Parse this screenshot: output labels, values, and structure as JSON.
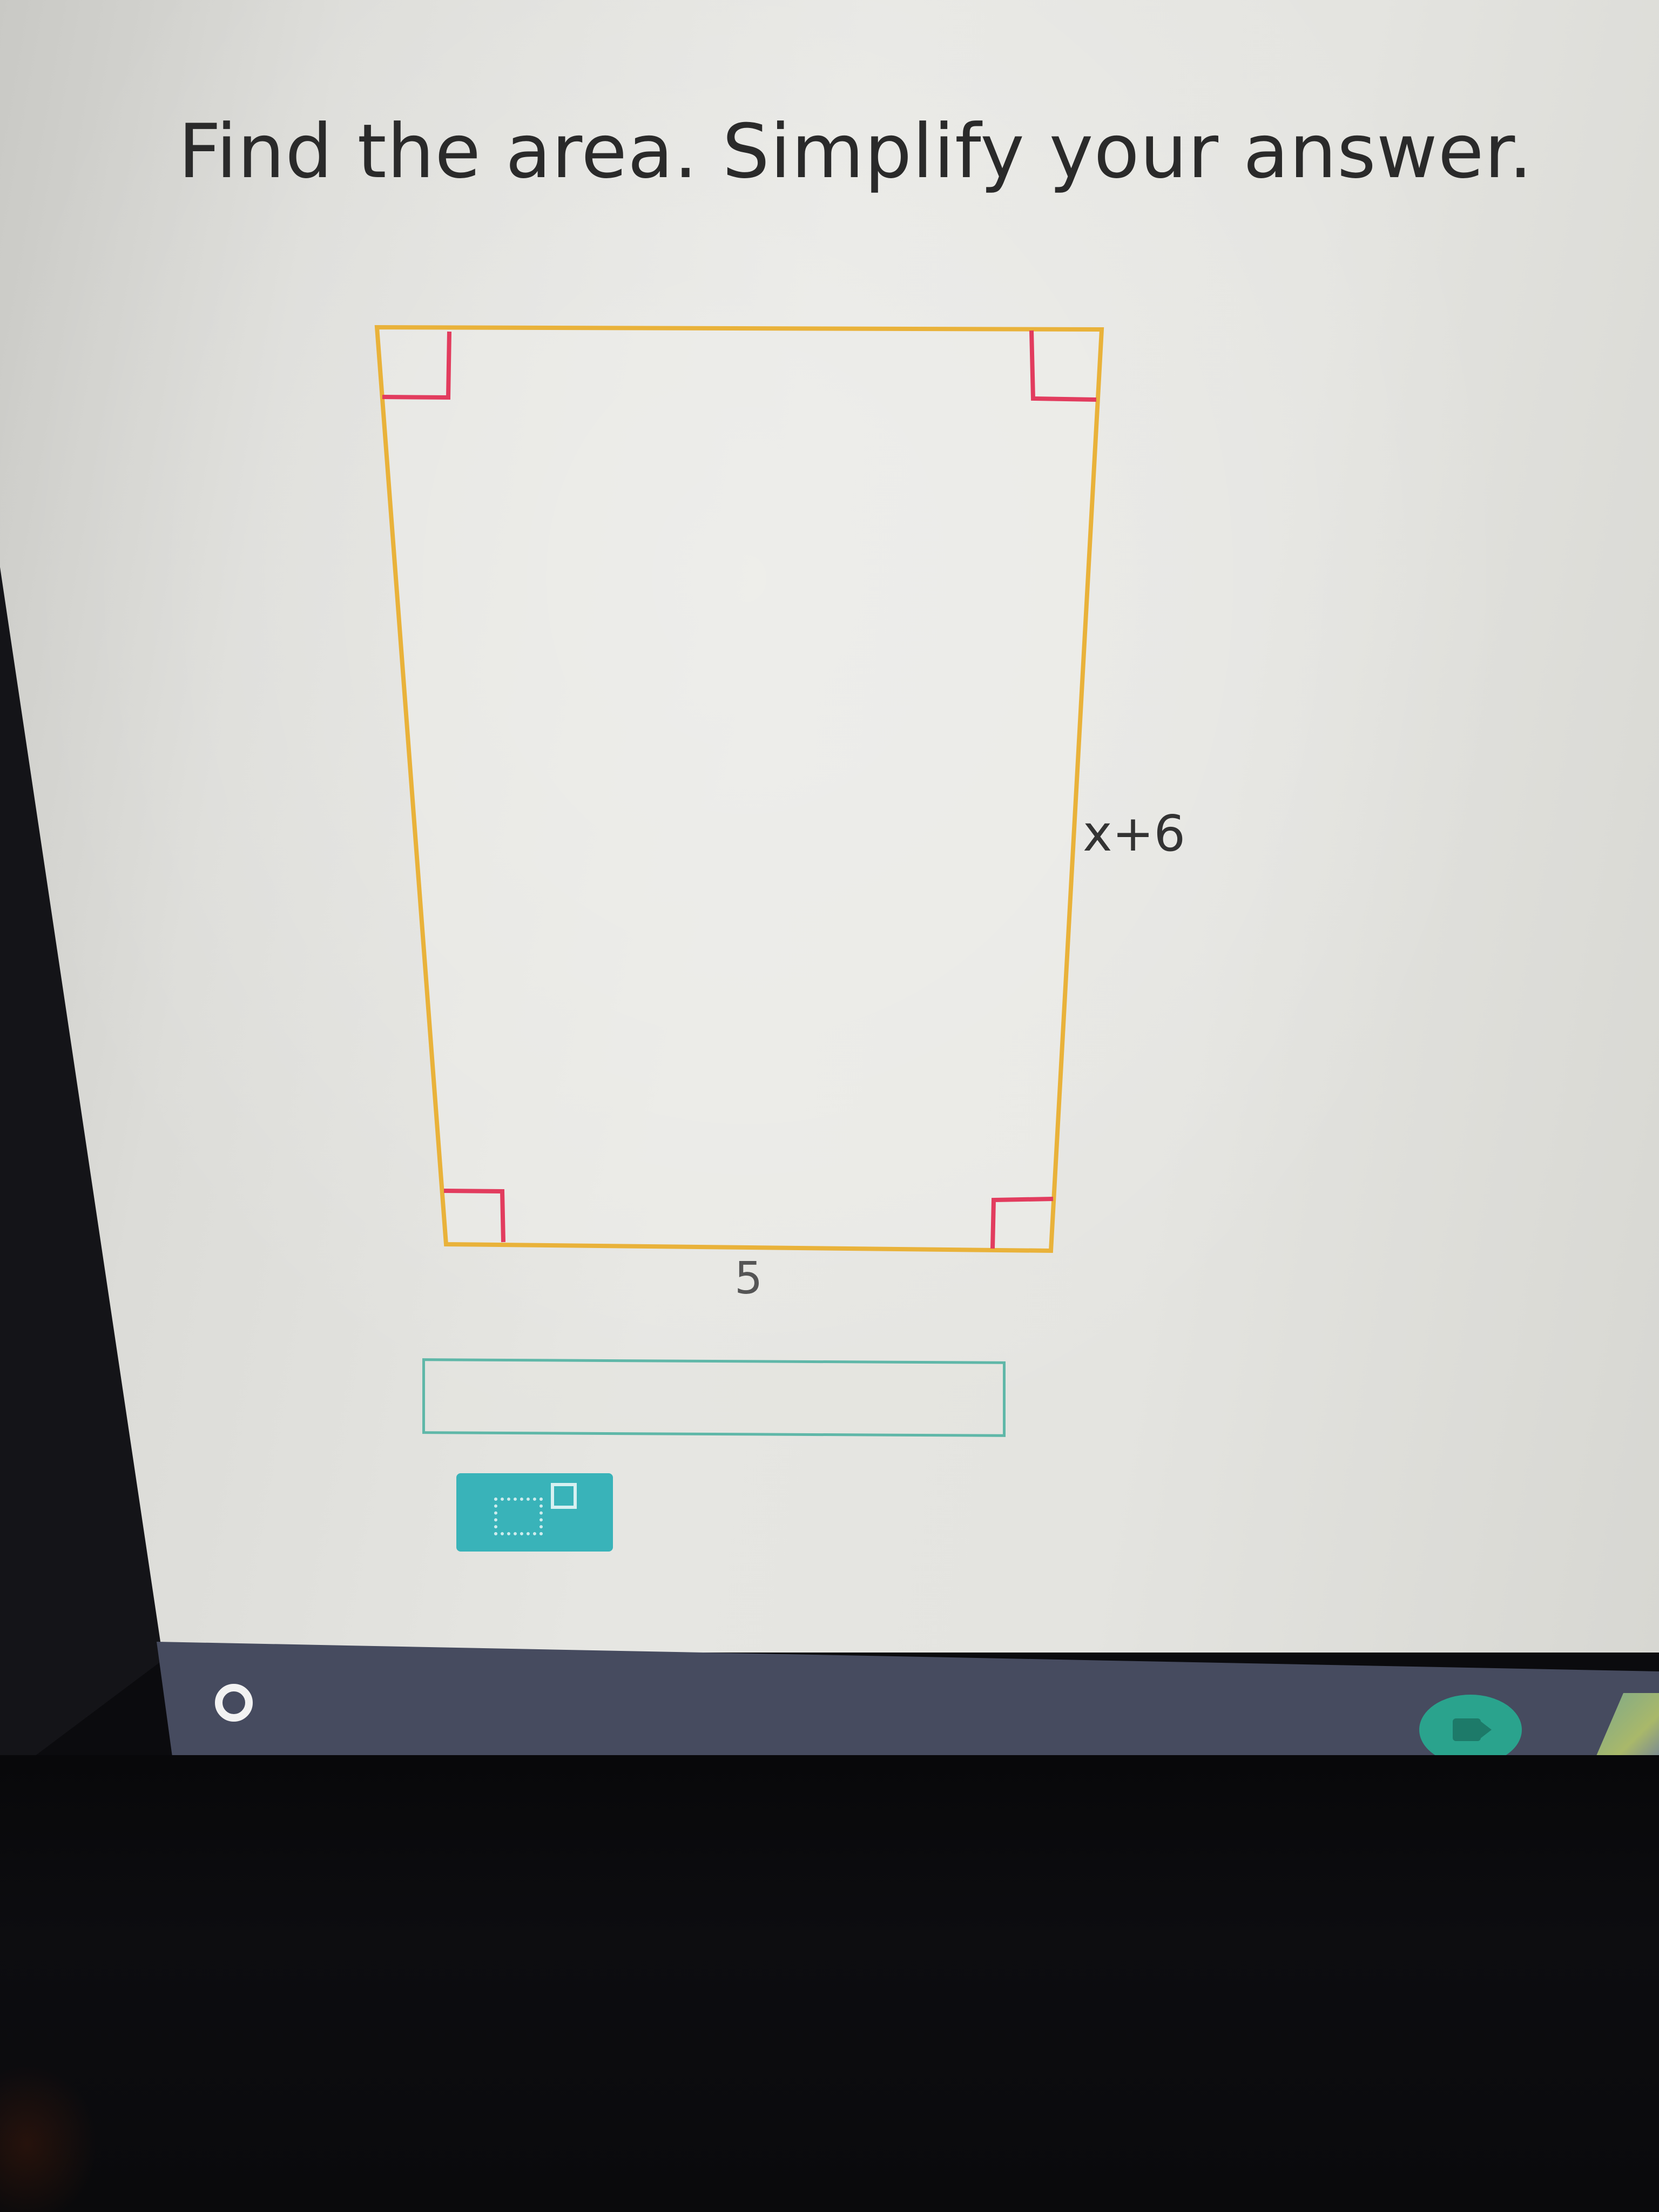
{
  "question": {
    "text": "Find the area. Simplify your answer."
  },
  "figure": {
    "side_label": "x+6",
    "bottom_label": "5",
    "colors": {
      "outline": "#e9b23a",
      "right_angle_marks": "#e23c5e"
    }
  },
  "answer": {
    "value": ""
  },
  "toolbar": {
    "math_button_icon": "exponent-template-icon",
    "button_color": "#39b3b9"
  },
  "taskbar": {
    "launcher_icon": "launcher-circle-icon",
    "apps": [
      {
        "icon": "meet-video-icon",
        "color": "#2aa38d"
      },
      {
        "icon": "drive-icon"
      }
    ]
  }
}
